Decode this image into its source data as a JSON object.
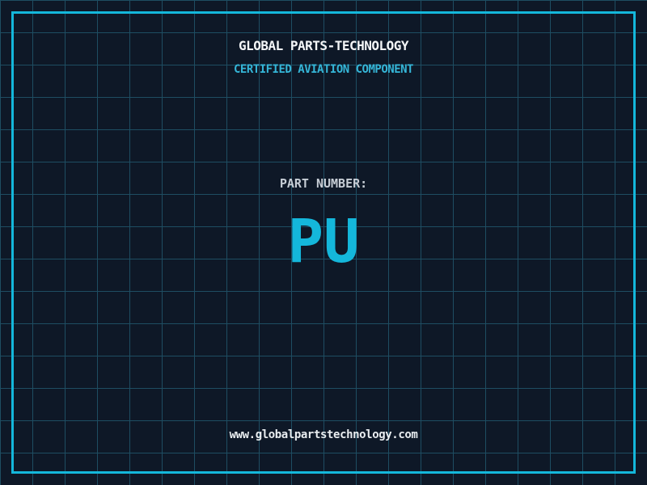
{
  "brand": {
    "title": "GLOBAL PARTS-TECHNOLOGY",
    "subtitle": "CERTIFIED AVIATION COMPONENT"
  },
  "part": {
    "label": "PART NUMBER:",
    "number": "PU"
  },
  "footer": {
    "website": "www.globalpartstechnology.com"
  },
  "colors": {
    "background": "#0e1827",
    "grid_line": "#1e4d62",
    "accent_cyan": "#14b7db",
    "title_text": "#f4f6f8",
    "subtitle_text": "#35b6d8",
    "label_text": "#c7ced6",
    "url_text": "#e9edf0"
  },
  "layout": {
    "grid_spacing_px": "40"
  }
}
